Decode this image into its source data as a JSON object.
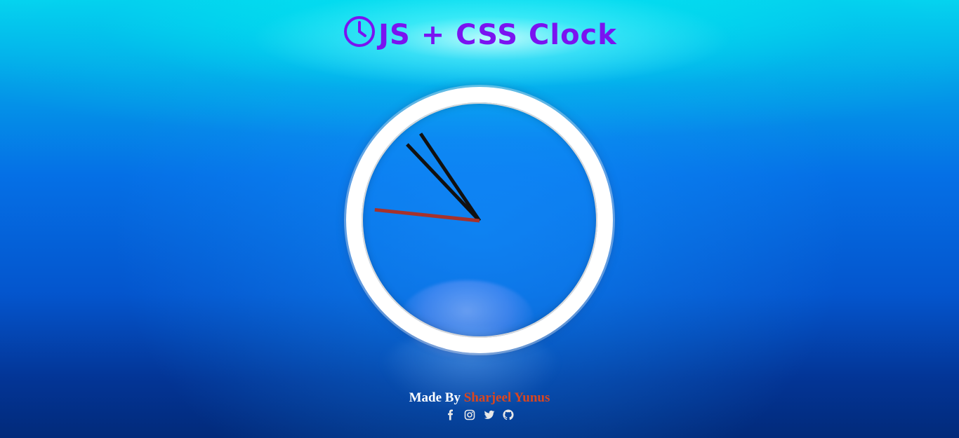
{
  "page": {
    "title": "JS + CSS Clock",
    "title_icon": "clock-icon",
    "title_color": "#7a13f0"
  },
  "clock": {
    "time_shown": {
      "hours": 10,
      "minutes": 52,
      "seconds": 46
    },
    "hand_colors": {
      "hour": "#111111",
      "minute": "#111111",
      "second": "#a7322b"
    },
    "face_border_color": "#ffffff"
  },
  "footer": {
    "made_by_label": "Made By",
    "author_name": "Sharjeel Yunus",
    "author_color": "#d9461f",
    "social_icons": [
      "facebook-icon",
      "instagram-icon",
      "twitter-icon",
      "github-icon"
    ]
  }
}
